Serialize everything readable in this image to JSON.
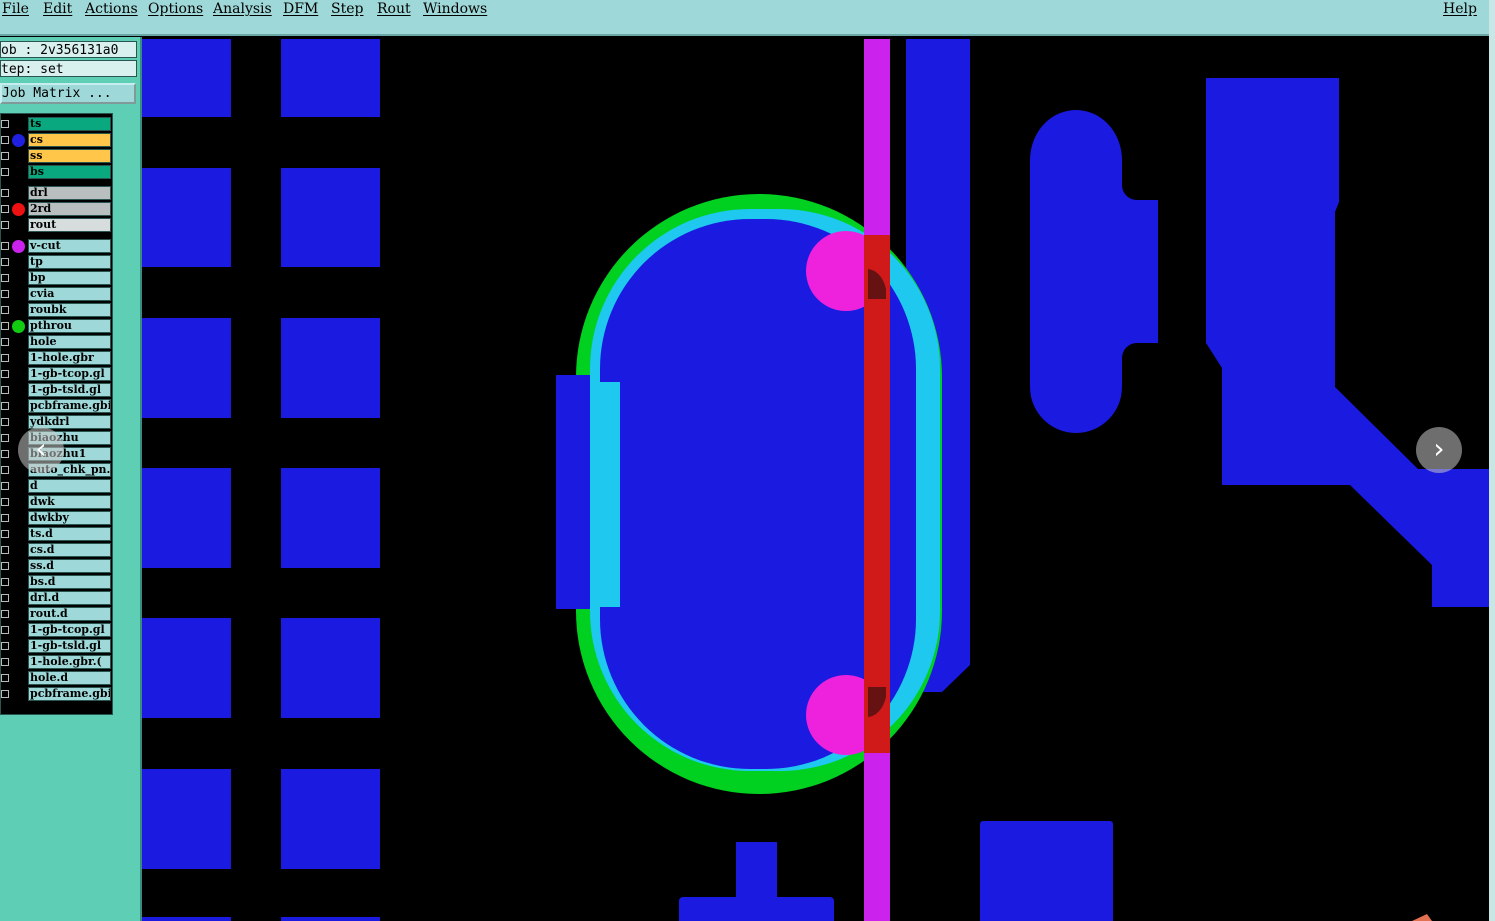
{
  "menubar": {
    "file": "File",
    "edit": "Edit",
    "actions": "Actions",
    "options": "Options",
    "analysis": "Analysis",
    "dfm": "DFM",
    "step": "Step",
    "rout": "Rout",
    "windows": "Windows",
    "help": "Help"
  },
  "panel": {
    "job": "ob : 2v356131a0",
    "step": "tep: set",
    "job_matrix": "Job Matrix ..."
  },
  "layers": [
    {
      "name": "ts",
      "color": "#0aa87e",
      "dot": ""
    },
    {
      "name": "cs",
      "color": "#ffc64a",
      "dot": "#2020e0"
    },
    {
      "name": "ss",
      "color": "#ffc64a",
      "dot": ""
    },
    {
      "name": "bs",
      "color": "#0aa87e",
      "dot": ""
    },
    {
      "name": "drl",
      "color": "#b9bfbf",
      "dot": ""
    },
    {
      "name": "2rd",
      "color": "#b9bfbf",
      "dot": "#ee1111"
    },
    {
      "name": "rout",
      "color": "#d7dddd",
      "dot": ""
    },
    {
      "name": "v-cut",
      "color": "#9fd8d8",
      "dot": "#cc22ee"
    },
    {
      "name": "tp",
      "color": "#9fd8d8",
      "dot": ""
    },
    {
      "name": "bp",
      "color": "#9fd8d8",
      "dot": ""
    },
    {
      "name": "cvia",
      "color": "#9fd8d8",
      "dot": ""
    },
    {
      "name": "roubk",
      "color": "#9fd8d8",
      "dot": ""
    },
    {
      "name": "pthrou",
      "color": "#9fd8d8",
      "dot": "#11cc11"
    },
    {
      "name": "hole",
      "color": "#9fd8d8",
      "dot": ""
    },
    {
      "name": "1-hole.gbr",
      "color": "#9fd8d8",
      "dot": ""
    },
    {
      "name": "1-gb-tcop.gl",
      "color": "#9fd8d8",
      "dot": ""
    },
    {
      "name": "1-gb-tsld.gl",
      "color": "#9fd8d8",
      "dot": ""
    },
    {
      "name": "pcbframe.gbi",
      "color": "#9fd8d8",
      "dot": ""
    },
    {
      "name": "ydkdrl",
      "color": "#9fd8d8",
      "dot": ""
    },
    {
      "name": "biaozhu",
      "color": "#9fd8d8",
      "dot": ""
    },
    {
      "name": "biaozhu1",
      "color": "#9fd8d8",
      "dot": ""
    },
    {
      "name": "auto_chk_pn.",
      "color": "#9fd8d8",
      "dot": ""
    },
    {
      "name": "d",
      "color": "#9fd8d8",
      "dot": ""
    },
    {
      "name": "dwk",
      "color": "#9fd8d8",
      "dot": ""
    },
    {
      "name": "dwkby",
      "color": "#9fd8d8",
      "dot": ""
    },
    {
      "name": "ts.d",
      "color": "#9fd8d8",
      "dot": ""
    },
    {
      "name": "cs.d",
      "color": "#9fd8d8",
      "dot": ""
    },
    {
      "name": "ss.d",
      "color": "#9fd8d8",
      "dot": ""
    },
    {
      "name": "bs.d",
      "color": "#9fd8d8",
      "dot": ""
    },
    {
      "name": "drl.d",
      "color": "#9fd8d8",
      "dot": ""
    },
    {
      "name": "rout.d",
      "color": "#9fd8d8",
      "dot": ""
    },
    {
      "name": "1-gb-tcop.gl",
      "color": "#9fd8d8",
      "dot": ""
    },
    {
      "name": "1-gb-tsld.gl",
      "color": "#9fd8d8",
      "dot": ""
    },
    {
      "name": "1-hole.gbr.(",
      "color": "#9fd8d8",
      "dot": ""
    },
    {
      "name": "hole.d",
      "color": "#9fd8d8",
      "dot": ""
    },
    {
      "name": "pcbframe.gbi",
      "color": "#9fd8d8",
      "dot": ""
    }
  ],
  "nav": {
    "prev_icon": "chevron-left-icon",
    "next_icon": "chevron-right-icon",
    "prev": "‹",
    "next": "›"
  },
  "colors": {
    "copper": "#1a1ae0",
    "vcut": "#cc22ee",
    "rout_line": "#d01a1a",
    "mask": "#1ec8ee",
    "outline": "#00d020",
    "drill": "#ee22dd"
  }
}
